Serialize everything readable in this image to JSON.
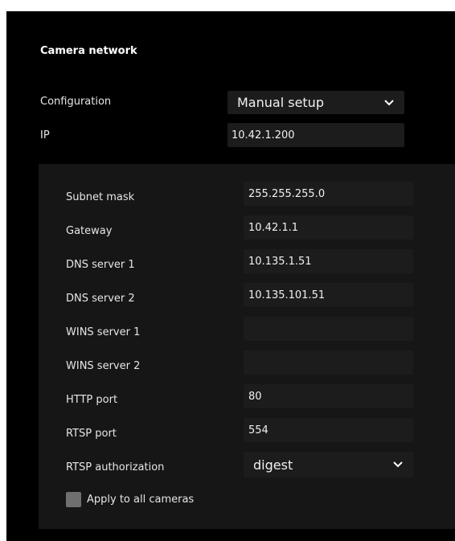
{
  "section": {
    "title": "Camera network"
  },
  "configuration": {
    "label": "Configuration",
    "value": "Manual setup"
  },
  "ip": {
    "label": "IP",
    "value": "10.42.1.200"
  },
  "fields": [
    {
      "label": "Subnet mask",
      "value": "255.255.255.0"
    },
    {
      "label": "Gateway",
      "value": "10.42.1.1"
    },
    {
      "label": "DNS server 1",
      "value": "10.135.1.51"
    },
    {
      "label": "DNS server 2",
      "value": "10.135.101.51"
    },
    {
      "label": "WINS server 1",
      "value": ""
    },
    {
      "label": "WINS server 2",
      "value": ""
    },
    {
      "label": "HTTP port",
      "value": "80"
    },
    {
      "label": "RTSP port",
      "value": "554"
    }
  ],
  "rtsp_authorization": {
    "label": "RTSP authorization",
    "value": "digest"
  },
  "apply_all": {
    "label": "Apply to all cameras",
    "checked": false
  },
  "colors": {
    "panel_background": "#000000",
    "subpanel_background": "#161616",
    "field_background": "#1c1c1c",
    "checkbox": "#6f6f6f"
  }
}
